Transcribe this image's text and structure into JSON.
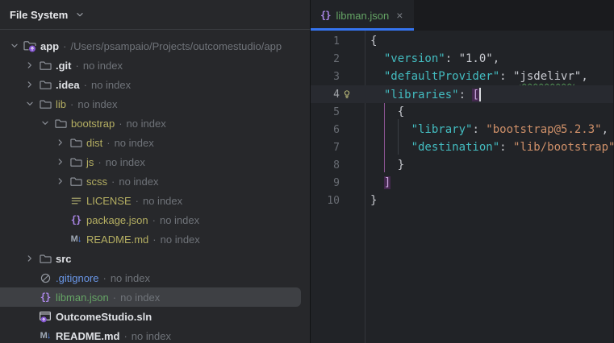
{
  "colors": {
    "accent": "#3574F0",
    "added_green": "#65A565",
    "modified_blue": "#6A97E8",
    "ignored_olive": "#B5AF62",
    "white_text": "#DFE1E5",
    "muted_gray": "#6F7379",
    "purple_icon": "#A985E4",
    "blue_icon": "#548AF7",
    "gray_icon": "#9499A1",
    "key_teal": "#43BCC0",
    "string_tan": "#CF9069"
  },
  "left_panel": {
    "title": "File System",
    "separator": "·",
    "tree": [
      {
        "name": "app",
        "note": "/Users/psampaio/Projects/outcomestudio/app",
        "icon": "module-folder",
        "level": 0,
        "chevron": "down",
        "color": "white",
        "bold": true
      },
      {
        "name": ".git",
        "note": "no index",
        "icon": "folder",
        "level": 1,
        "chevron": "right",
        "color": "white"
      },
      {
        "name": ".idea",
        "note": "no index",
        "icon": "folder",
        "level": 1,
        "chevron": "right",
        "color": "white"
      },
      {
        "name": "lib",
        "note": "no index",
        "icon": "folder",
        "level": 1,
        "chevron": "down",
        "color": "ignored"
      },
      {
        "name": "bootstrap",
        "note": "no index",
        "icon": "folder",
        "level": 2,
        "chevron": "down",
        "color": "ignored"
      },
      {
        "name": "dist",
        "note": "no index",
        "icon": "folder",
        "level": 3,
        "chevron": "right",
        "color": "ignored"
      },
      {
        "name": "js",
        "note": "no index",
        "icon": "folder",
        "level": 3,
        "chevron": "right",
        "color": "ignored"
      },
      {
        "name": "scss",
        "note": "no index",
        "icon": "folder",
        "level": 3,
        "chevron": "right",
        "color": "ignored"
      },
      {
        "name": "LICENSE",
        "note": "no index",
        "icon": "text-file",
        "level": 3,
        "chevron": null,
        "color": "ignored"
      },
      {
        "name": "package.json",
        "note": "no index",
        "icon": "json-braces",
        "level": 3,
        "chevron": null,
        "color": "ignored"
      },
      {
        "name": "README.md",
        "note": "no index",
        "icon": "markdown",
        "level": 3,
        "chevron": null,
        "color": "ignored"
      },
      {
        "name": "src",
        "note": null,
        "icon": "folder",
        "level": 1,
        "chevron": "right",
        "color": "white"
      },
      {
        "name": ".gitignore",
        "note": "no index",
        "icon": "ignore",
        "level": 1,
        "chevron": null,
        "color": "modified"
      },
      {
        "name": "libman.json",
        "note": "no index",
        "icon": "json-braces",
        "level": 1,
        "chevron": null,
        "color": "added",
        "selected": true
      },
      {
        "name": "OutcomeStudio.sln",
        "note": null,
        "icon": "solution",
        "level": 1,
        "chevron": null,
        "color": "white"
      },
      {
        "name": "README.md",
        "note": "no index",
        "icon": "markdown",
        "level": 1,
        "chevron": null,
        "color": "white"
      }
    ]
  },
  "editor": {
    "tab": {
      "icon": "json-braces",
      "label": "libman.json",
      "close_label": "×"
    },
    "lines": [
      {
        "n": "1",
        "tokens": [
          {
            "t": "{",
            "c": "p"
          }
        ]
      },
      {
        "n": "2",
        "tokens": [
          {
            "t": "  ",
            "c": "p"
          },
          {
            "t": "\"version\"",
            "c": "key"
          },
          {
            "t": ": ",
            "c": "p"
          },
          {
            "t": "\"1.0\"",
            "c": "val"
          },
          {
            "t": ",",
            "c": "p"
          }
        ]
      },
      {
        "n": "3",
        "tokens": [
          {
            "t": "  ",
            "c": "p"
          },
          {
            "t": "\"defaultProvider\"",
            "c": "key"
          },
          {
            "t": ": ",
            "c": "p"
          },
          {
            "t": "\"",
            "c": "val"
          },
          {
            "t": "jsdelivr",
            "c": "val typo"
          },
          {
            "t": "\"",
            "c": "val"
          },
          {
            "t": ",",
            "c": "p"
          }
        ]
      },
      {
        "n": "4",
        "bulb": true,
        "current": true,
        "tokens": [
          {
            "t": "  ",
            "c": "p"
          },
          {
            "t": "\"libraries\"",
            "c": "key"
          },
          {
            "t": ": ",
            "c": "p"
          },
          {
            "t": "[",
            "c": "match"
          },
          {
            "caret": true
          }
        ]
      },
      {
        "n": "5",
        "tokens": [
          {
            "t": "    {",
            "c": "p"
          }
        ]
      },
      {
        "n": "6",
        "tokens": [
          {
            "t": "      ",
            "c": "p"
          },
          {
            "t": "\"library\"",
            "c": "key"
          },
          {
            "t": ": ",
            "c": "p"
          },
          {
            "t": "\"bootstrap@5.2.3\"",
            "c": "str"
          },
          {
            "t": ",",
            "c": "p"
          }
        ]
      },
      {
        "n": "7",
        "tokens": [
          {
            "t": "      ",
            "c": "p"
          },
          {
            "t": "\"destination\"",
            "c": "key"
          },
          {
            "t": ": ",
            "c": "p"
          },
          {
            "t": "\"lib/bootstrap\"",
            "c": "str"
          }
        ]
      },
      {
        "n": "8",
        "tokens": [
          {
            "t": "    }",
            "c": "p"
          }
        ]
      },
      {
        "n": "9",
        "tokens": [
          {
            "t": "  ",
            "c": "p"
          },
          {
            "t": "]",
            "c": "match"
          }
        ]
      },
      {
        "n": "10",
        "tokens": [
          {
            "t": "}",
            "c": "p"
          }
        ]
      }
    ]
  }
}
